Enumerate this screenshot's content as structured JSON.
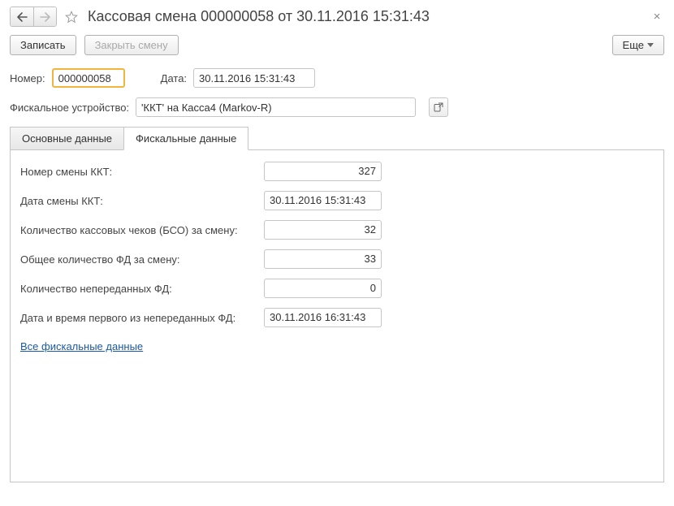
{
  "header": {
    "title": "Кассовая смена 000000058 от 30.11.2016 15:31:43"
  },
  "toolbar": {
    "write_label": "Записать",
    "close_shift_label": "Закрыть смену",
    "more_label": "Еще"
  },
  "form": {
    "number_label": "Номер:",
    "number_value": "000000058",
    "date_label": "Дата:",
    "date_value": "30.11.2016 15:31:43",
    "device_label": "Фискальное устройство:",
    "device_value": "'ККТ' на Касса4 (Markov-R)"
  },
  "tabs": {
    "main_label": "Основные данные",
    "fiscal_label": "Фискальные данные"
  },
  "fiscal": {
    "shift_number_label": "Номер смены ККТ:",
    "shift_number_value": "327",
    "shift_date_label": "Дата смены ККТ:",
    "shift_date_value": "30.11.2016 15:31:43",
    "checks_count_label": "Количество кассовых чеков (БСО) за смену:",
    "checks_count_value": "32",
    "fd_total_label": "Общее количество ФД за смену:",
    "fd_total_value": "33",
    "fd_unsent_label": "Количество непереданных ФД:",
    "fd_unsent_value": "0",
    "fd_first_unsent_date_label": "Дата и время первого из непереданных ФД:",
    "fd_first_unsent_date_value": "30.11.2016 16:31:43",
    "all_fiscal_link": "Все фискальные данные"
  }
}
